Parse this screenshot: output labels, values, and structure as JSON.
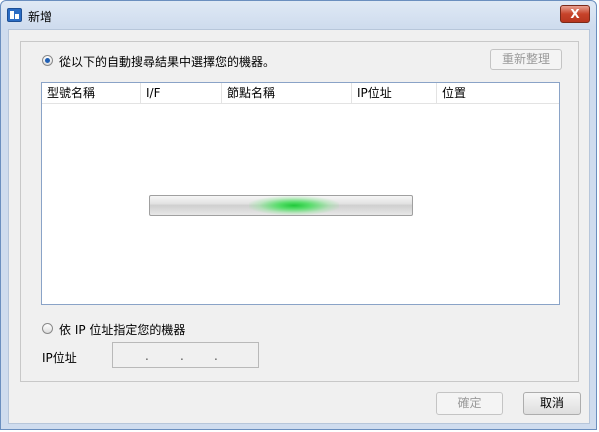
{
  "window": {
    "title": "新增",
    "close_label": "X"
  },
  "auto_search": {
    "label": "從以下的自動搜尋結果中選擇您的機器。",
    "selected": true,
    "refresh_label": "重新整理"
  },
  "list": {
    "columns": [
      "型號名稱",
      "I/F",
      "節點名稱",
      "IP位址",
      "位置"
    ],
    "rows": []
  },
  "progress": {
    "position": 0.55
  },
  "manual": {
    "label": "依 IP 位址指定您的機器",
    "selected": false,
    "ip_label": "IP位址",
    "ip_separator": "."
  },
  "buttons": {
    "ok": "確定",
    "cancel": "取消"
  }
}
